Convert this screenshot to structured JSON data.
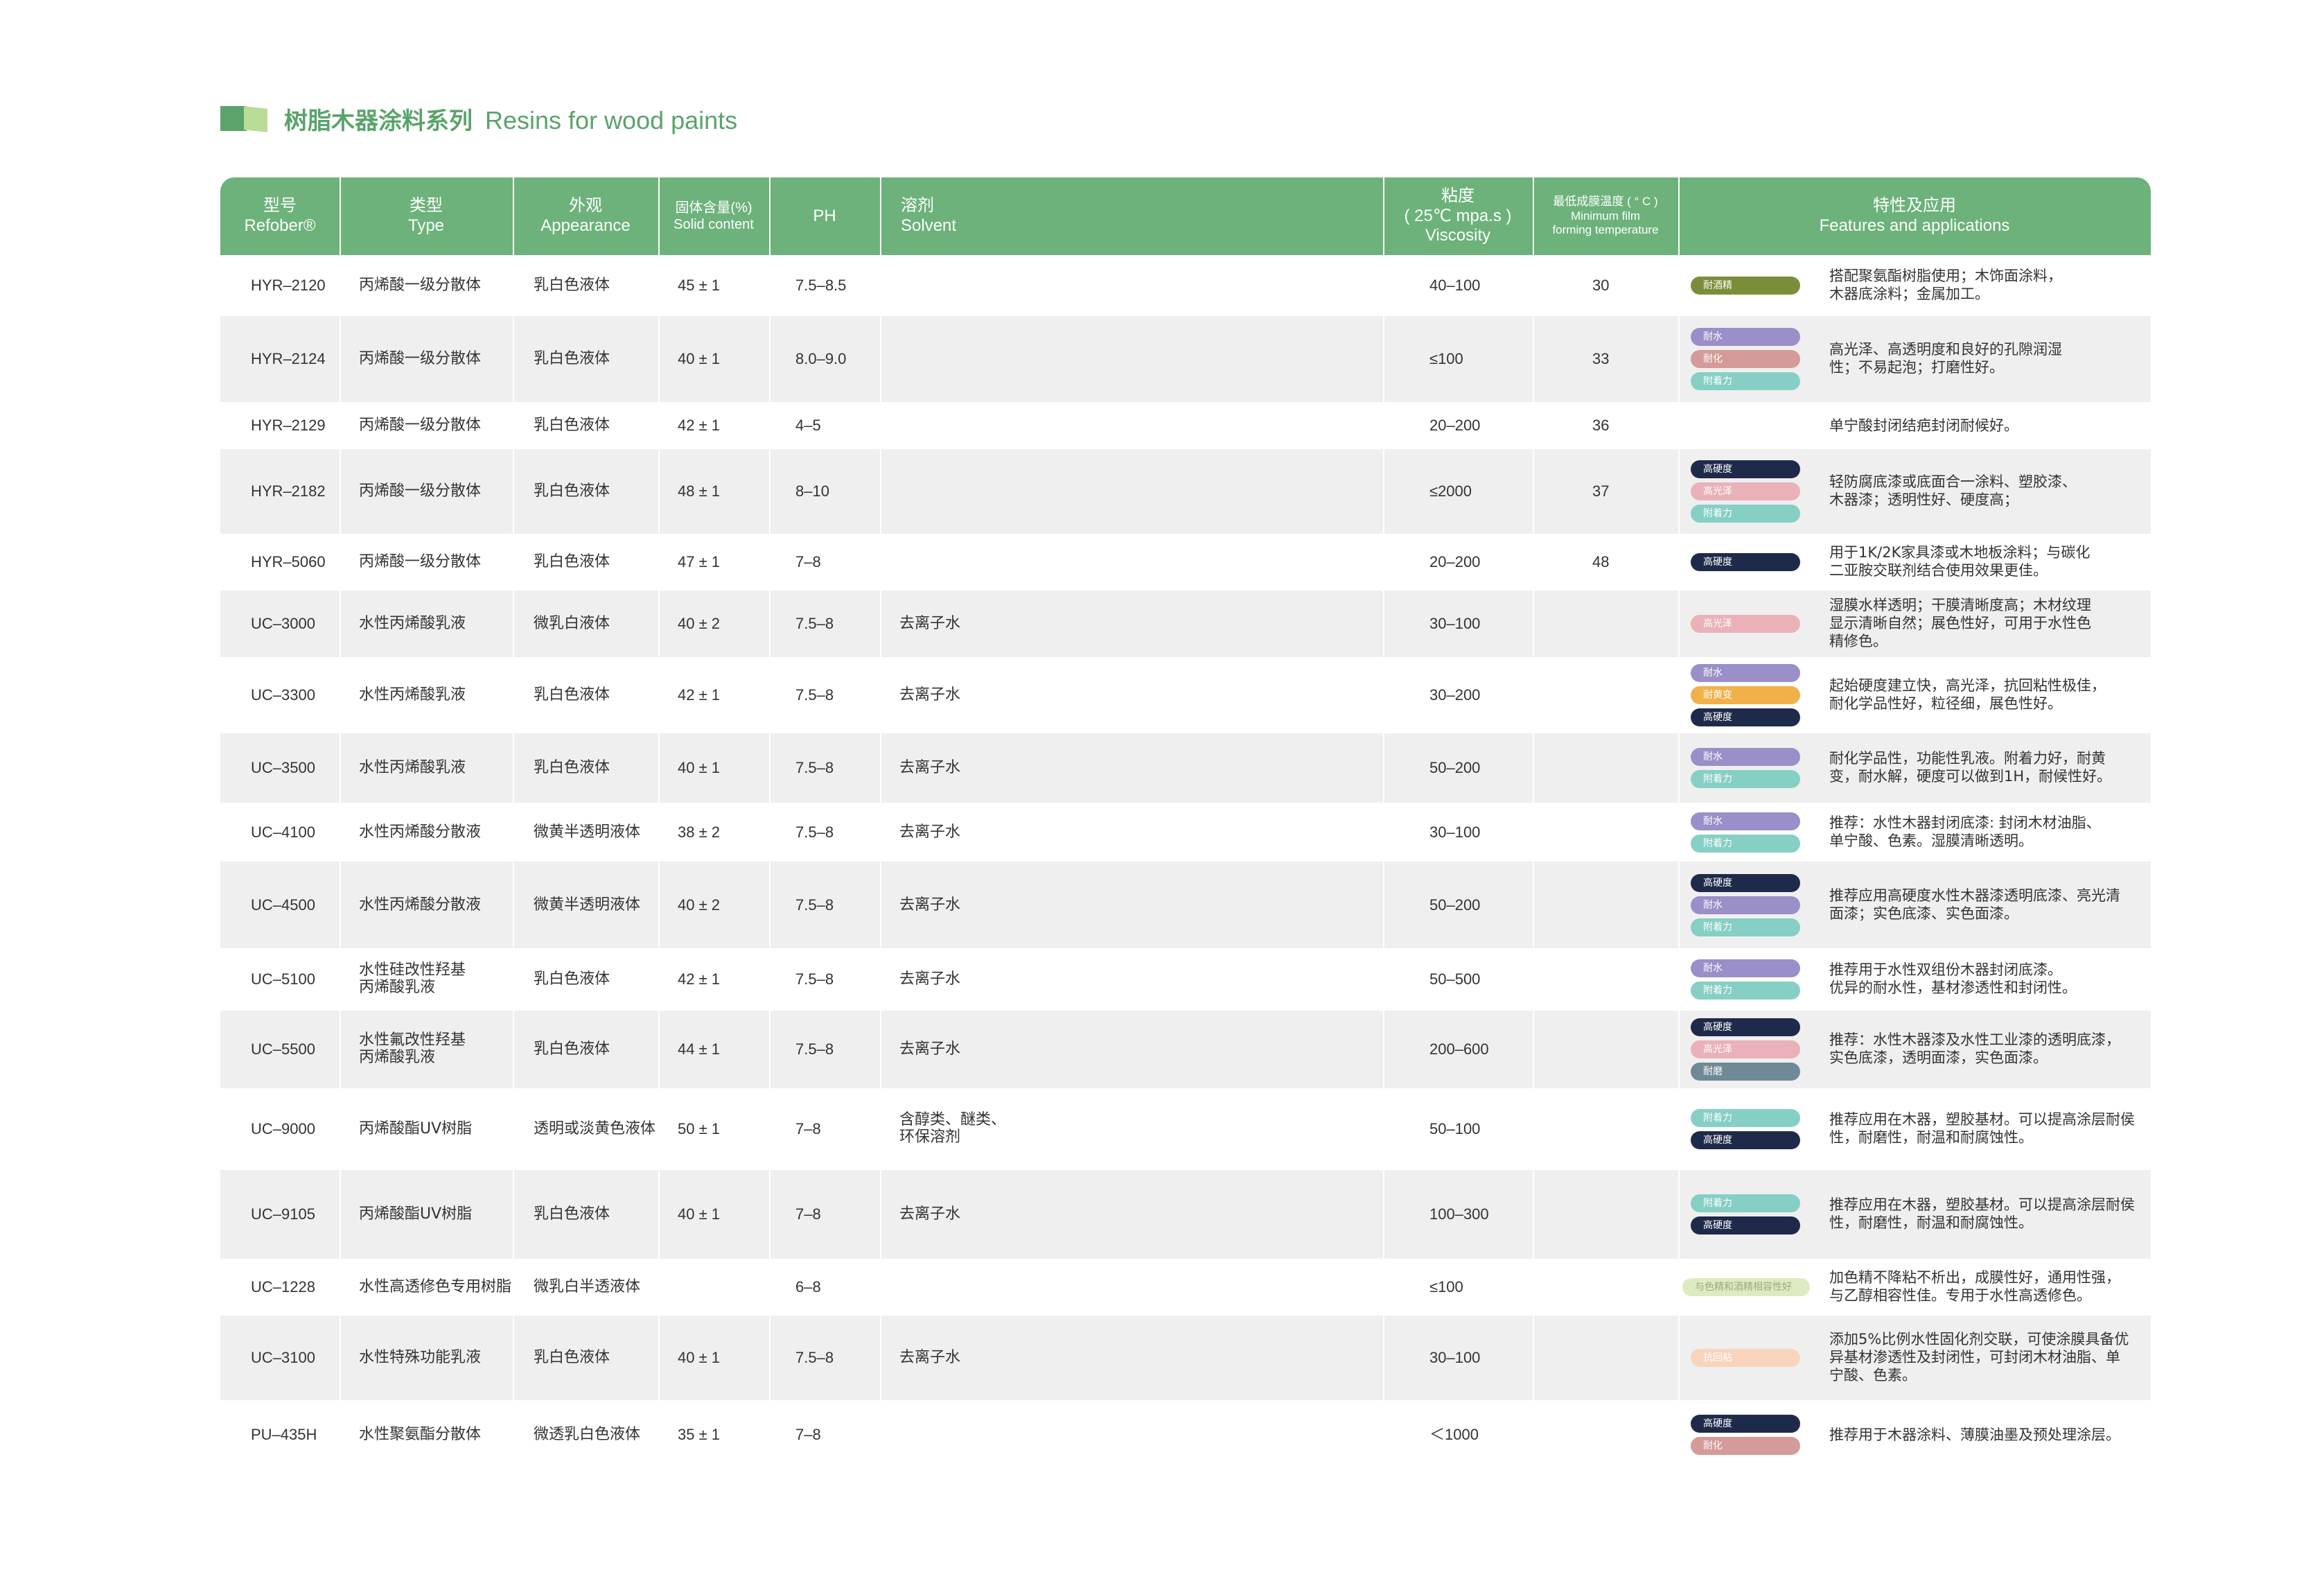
{
  "title": {
    "cn": "树脂木器涂料系列",
    "en": "Resins for wood paints"
  },
  "colors": {
    "green_header": "#6cb27a",
    "title_green": "#5aa36a",
    "row_shade": "#efefef"
  },
  "columns": {
    "model": [
      "型号",
      "Refober®"
    ],
    "type": [
      "类型",
      "Type"
    ],
    "appearance": [
      "外观",
      "Appearance"
    ],
    "solid": [
      "固体含量(%)",
      "Solid content"
    ],
    "ph": [
      "PH"
    ],
    "solvent": [
      "溶剂",
      "Solvent"
    ],
    "viscosity": [
      "粘度",
      "( 25℃ mpa.s )",
      "Viscosity"
    ],
    "mfft": [
      "最低成膜温度 ( ° C )",
      "Minimum film",
      "forming temperature"
    ],
    "features": [
      "特性及应用",
      "Features and applications"
    ]
  },
  "badge_colors": {
    "耐酒精": "#7a8e3a",
    "耐水": "#9a8fc8",
    "耐化": "#d59a9a",
    "附着力": "#86cfc4",
    "高硬度": "#1e2a4a",
    "高光泽": "#eab1b8",
    "耐黄变": "#f2b04a",
    "耐磨": "#6f8a96",
    "与色精和酒精相容性好": "#dcecc0",
    "抗回粘": "#f8d4bc"
  },
  "rows": [
    {
      "model": "HYR–2120",
      "type": [
        "丙烯酸一级分散体"
      ],
      "appearance": "乳白色液体",
      "solid": "45 ± 1",
      "ph": "7.5–8.5",
      "solvent": [],
      "viscosity": "40–100",
      "mfft": "30",
      "badges": [
        "耐酒精"
      ],
      "features": [
        "搭配聚氨酯树脂使用；木饰面涂料，",
        "木器底涂料；金属加工。"
      ]
    },
    {
      "model": "HYR–2124",
      "type": [
        "丙烯酸一级分散体"
      ],
      "appearance": "乳白色液体",
      "solid": "40 ± 1",
      "ph": "8.0–9.0",
      "solvent": [],
      "viscosity": "≤100",
      "mfft": "33",
      "badges": [
        "耐水",
        "耐化",
        "附着力"
      ],
      "features": [
        "高光泽、高透明度和良好的孔隙润湿",
        "性；不易起泡；打磨性好。"
      ]
    },
    {
      "model": "HYR–2129",
      "type": [
        "丙烯酸一级分散体"
      ],
      "appearance": "乳白色液体",
      "solid": "42 ± 1",
      "ph": "4–5",
      "solvent": [],
      "viscosity": "20–200",
      "mfft": "36",
      "badges": [],
      "features": [
        "单宁酸封闭结疤封闭耐候好。"
      ]
    },
    {
      "model": "HYR–2182",
      "type": [
        "丙烯酸一级分散体"
      ],
      "appearance": "乳白色液体",
      "solid": "48 ± 1",
      "ph": "8–10",
      "solvent": [],
      "viscosity": "≤2000",
      "mfft": "37",
      "badges": [
        "高硬度",
        "高光泽",
        "附着力"
      ],
      "features": [
        "轻防腐底漆或底面合一涂料、塑胶漆、",
        "木器漆；透明性好、硬度高；"
      ]
    },
    {
      "model": "HYR–5060",
      "type": [
        "丙烯酸一级分散体"
      ],
      "appearance": "乳白色液体",
      "solid": "47 ± 1",
      "ph": "7–8",
      "solvent": [],
      "viscosity": "20–200",
      "mfft": "48",
      "badges": [
        "高硬度"
      ],
      "features": [
        "用于1K/2K家具漆或木地板涂料；与碳化",
        "二亚胺交联剂结合使用效果更佳。"
      ]
    },
    {
      "model": "UC–3000",
      "type": [
        "水性丙烯酸乳液"
      ],
      "appearance": "微乳白液体",
      "solid": "40 ± 2",
      "ph": "7.5–8",
      "solvent": [
        "去离子水"
      ],
      "viscosity": "30–100",
      "mfft": "",
      "badges": [
        "高光泽"
      ],
      "features": [
        "湿膜水样透明；干膜清晰度高；木材纹理",
        "显示清晰自然；展色性好，可用于水性色",
        "精修色。"
      ]
    },
    {
      "model": "UC–3300",
      "type": [
        "水性丙烯酸乳液"
      ],
      "appearance": "乳白色液体",
      "solid": "42 ± 1",
      "ph": "7.5–8",
      "solvent": [
        "去离子水"
      ],
      "viscosity": "30–200",
      "mfft": "",
      "badges": [
        "耐水",
        "耐黄变",
        "高硬度"
      ],
      "features": [
        "起始硬度建立快，高光泽，抗回粘性极佳，",
        "耐化学品性好，粒径细，展色性好。"
      ]
    },
    {
      "model": "UC–3500",
      "type": [
        "水性丙烯酸乳液"
      ],
      "appearance": "乳白色液体",
      "solid": "40 ± 1",
      "ph": "7.5–8",
      "solvent": [
        "去离子水"
      ],
      "viscosity": "50–200",
      "mfft": "",
      "badges": [
        "耐水",
        "附着力"
      ],
      "features": [
        "耐化学品性，功能性乳液。附着力好，耐黄",
        "变，耐水解，硬度可以做到1H，耐候性好。"
      ]
    },
    {
      "model": "UC–4100",
      "type": [
        "水性丙烯酸分散液"
      ],
      "appearance": "微黄半透明液体",
      "solid": "38 ± 2",
      "ph": "7.5–8",
      "solvent": [
        "去离子水"
      ],
      "viscosity": "30–100",
      "mfft": "",
      "badges": [
        "耐水",
        "附着力"
      ],
      "features": [
        "推荐：水性木器封闭底漆: 封闭木材油脂、",
        "单宁酸、色素。湿膜清晰透明。"
      ]
    },
    {
      "model": "UC–4500",
      "type": [
        "水性丙烯酸分散液"
      ],
      "appearance": "微黄半透明液体",
      "solid": "40 ± 2",
      "ph": "7.5–8",
      "solvent": [
        "去离子水"
      ],
      "viscosity": "50–200",
      "mfft": "",
      "badges": [
        "高硬度",
        "耐水",
        "附着力"
      ],
      "features": [
        "推荐应用高硬度水性木器漆透明底漆、亮光清",
        "面漆；实色底漆、实色面漆。"
      ]
    },
    {
      "model": "UC–5100",
      "type": [
        "水性硅改性羟基",
        "丙烯酸乳液"
      ],
      "appearance": "乳白色液体",
      "solid": "42 ± 1",
      "ph": "7.5–8",
      "solvent": [
        "去离子水"
      ],
      "viscosity": "50–500",
      "mfft": "",
      "badges": [
        "耐水",
        "附着力"
      ],
      "features": [
        "推荐用于水性双组份木器封闭底漆。",
        "优异的耐水性，基材渗透性和封闭性。"
      ]
    },
    {
      "model": "UC–5500",
      "type": [
        "水性氟改性羟基",
        "丙烯酸乳液"
      ],
      "appearance": "乳白色液体",
      "solid": "44 ± 1",
      "ph": "7.5–8",
      "solvent": [
        "去离子水"
      ],
      "viscosity": "200–600",
      "mfft": "",
      "badges": [
        "高硬度",
        "高光泽",
        "耐磨"
      ],
      "features": [
        "推荐：水性木器漆及水性工业漆的透明底漆，",
        "实色底漆，透明面漆，实色面漆。"
      ]
    },
    {
      "model": "UC–9000",
      "type": [
        "丙烯酸酯UV树脂"
      ],
      "appearance": "透明或淡黄色液体",
      "solid": "50 ± 1",
      "ph": "7–8",
      "solvent": [
        "含醇类、醚类、",
        "环保溶剂"
      ],
      "viscosity": "50–100",
      "mfft": "",
      "badges": [
        "附着力",
        "高硬度"
      ],
      "features": [
        "推荐应用在木器，塑胶基材。可以提高涂层耐侯",
        "性，耐磨性，耐温和耐腐蚀性。"
      ]
    },
    {
      "model": "UC–9105",
      "type": [
        "丙烯酸酯UV树脂"
      ],
      "appearance": "乳白色液体",
      "solid": "40 ± 1",
      "ph": "7–8",
      "solvent": [
        "去离子水"
      ],
      "viscosity": "100–300",
      "mfft": "",
      "badges": [
        "附着力",
        "高硬度"
      ],
      "features": [
        "推荐应用在木器，塑胶基材。可以提高涂层耐侯",
        "性，耐磨性，耐温和耐腐蚀性。"
      ]
    },
    {
      "model": "UC–1228",
      "type": [
        "水性高透修色专用树脂"
      ],
      "appearance": "微乳白半透液体",
      "solid": "",
      "ph": "6–8",
      "solvent": [],
      "viscosity": "≤100",
      "mfft": "",
      "badges": [
        "与色精和酒精相容性好"
      ],
      "features": [
        "加色精不降粘不析出，成膜性好，通用性强，",
        "与乙醇相容性佳。专用于水性高透修色。"
      ]
    },
    {
      "model": "UC–3100",
      "type": [
        "水性特殊功能乳液"
      ],
      "appearance": "乳白色液体",
      "solid": "40 ± 1",
      "ph": "7.5–8",
      "solvent": [
        "去离子水"
      ],
      "viscosity": "30–100",
      "mfft": "",
      "badges": [
        "抗回粘"
      ],
      "features": [
        "添加5%比例水性固化剂交联，可使涂膜具备优",
        "异基材渗透性及封闭性，可封闭木材油脂、单",
        "宁酸、色素。"
      ]
    },
    {
      "model": "PU–435H",
      "type": [
        "水性聚氨酯分散体"
      ],
      "appearance": "微透乳白色液体",
      "solid": "35 ± 1",
      "ph": "7–8",
      "solvent": [],
      "viscosity": "＜1000",
      "mfft": "",
      "badges": [
        "高硬度",
        "耐化"
      ],
      "features": [
        "推荐用于木器涂料、薄膜油墨及预处理涂层。"
      ]
    }
  ]
}
